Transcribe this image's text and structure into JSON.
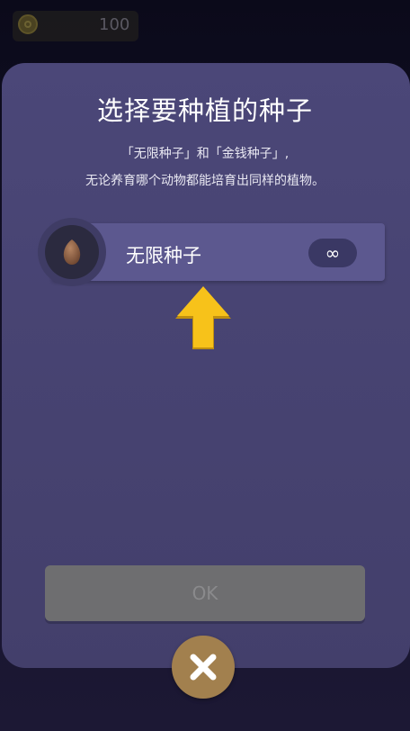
{
  "currency": {
    "amount": "100",
    "icon": "coin-icon"
  },
  "dialog": {
    "title": "选择要种植的种子",
    "desc_line1": "「无限种子」和「金钱种子」,",
    "desc_line2": "无论养育哪个动物都能培育出同样的植物。"
  },
  "seeds": [
    {
      "name": "无限种子",
      "count": "∞",
      "icon": "seed-icon"
    }
  ],
  "buttons": {
    "ok_label": "OK",
    "close_icon": "close-icon"
  },
  "colors": {
    "dialog_bg": "#4b4778",
    "seed_row_bg": "#5c588f",
    "arrow": "#f7c21a",
    "close_button": "#a2804e",
    "ok_button_disabled": "#6e6e70"
  }
}
